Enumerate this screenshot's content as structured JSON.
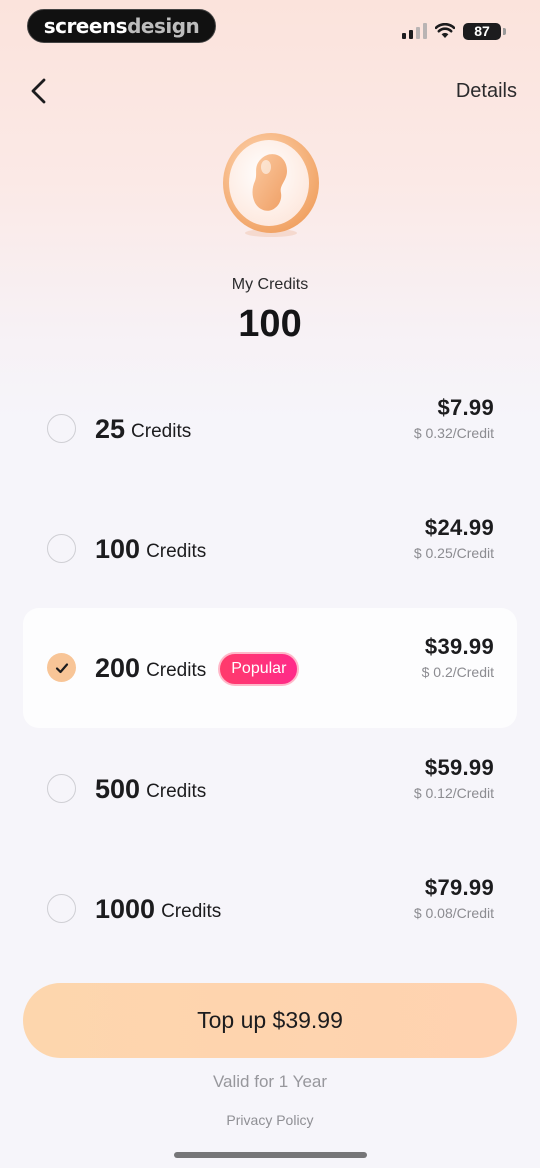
{
  "status_bar": {
    "brand_first": "screens",
    "brand_second": "design",
    "battery": "87"
  },
  "nav": {
    "details_label": "Details"
  },
  "balance": {
    "label": "My Credits",
    "value": "100"
  },
  "packages": [
    {
      "amount": "25",
      "unit": "Credits",
      "price": "$7.99",
      "per_credit": "$ 0.32/Credit",
      "selected": false
    },
    {
      "amount": "100",
      "unit": "Credits",
      "price": "$24.99",
      "per_credit": "$ 0.25/Credit",
      "selected": false
    },
    {
      "amount": "200",
      "unit": "Credits",
      "price": "$39.99",
      "per_credit": "$ 0.2/Credit",
      "selected": true,
      "badge": "Popular"
    },
    {
      "amount": "500",
      "unit": "Credits",
      "price": "$59.99",
      "per_credit": "$ 0.12/Credit",
      "selected": false
    },
    {
      "amount": "1000",
      "unit": "Credits",
      "price": "$79.99",
      "per_credit": "$ 0.08/Credit",
      "selected": false
    }
  ],
  "footer": {
    "topup_label": "Top up $39.99",
    "validity": "Valid for 1 Year",
    "privacy": "Privacy Policy"
  },
  "colors": {
    "accent_peach": "#f8c597",
    "badge_pink": "#ff3b6b",
    "coin_orange": "#f3a46a"
  },
  "icons": [
    "back-chevron-icon",
    "signal-icon",
    "wifi-icon",
    "battery-icon",
    "coin-bean-icon",
    "checkmark-icon"
  ]
}
